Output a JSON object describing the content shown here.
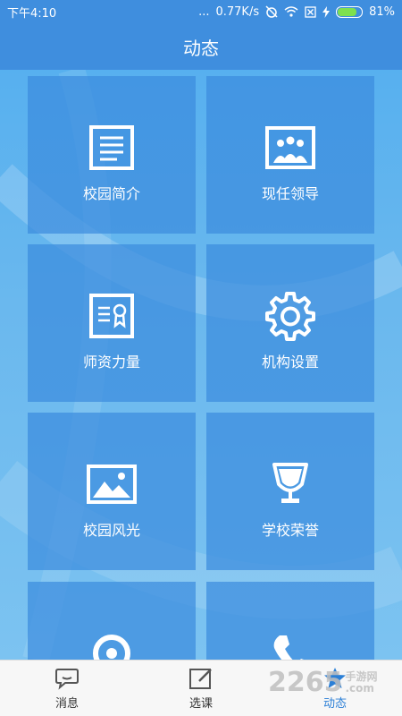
{
  "status_bar": {
    "time": "下午4:10",
    "dots": "...",
    "speed": "0.77K/s",
    "battery_percent": "81%",
    "battery_level": 0.81
  },
  "header": {
    "title": "动态"
  },
  "tiles": [
    {
      "label": "校园简介",
      "icon": "document-icon"
    },
    {
      "label": "现任领导",
      "icon": "group-photo-icon"
    },
    {
      "label": "师资力量",
      "icon": "certificate-icon"
    },
    {
      "label": "机构设置",
      "icon": "gear-icon"
    },
    {
      "label": "校园风光",
      "icon": "landscape-icon"
    },
    {
      "label": "学校荣誉",
      "icon": "trophy-icon"
    },
    {
      "label": "",
      "icon": "location-icon"
    },
    {
      "label": "",
      "icon": "phone-icon"
    }
  ],
  "tabbar": {
    "tabs": [
      {
        "label": "消息",
        "icon": "chat-icon",
        "active": false
      },
      {
        "label": "选课",
        "icon": "edit-icon",
        "active": false
      },
      {
        "label": "动态",
        "icon": "star-icon",
        "active": true
      }
    ]
  },
  "watermark": {
    "main": "2265",
    "sub_line1": "手游网",
    "sub_line2": ".com"
  },
  "colors": {
    "header": "#3f8ede",
    "tile": "#3c8cde",
    "active_tab": "#2b7fd6"
  }
}
